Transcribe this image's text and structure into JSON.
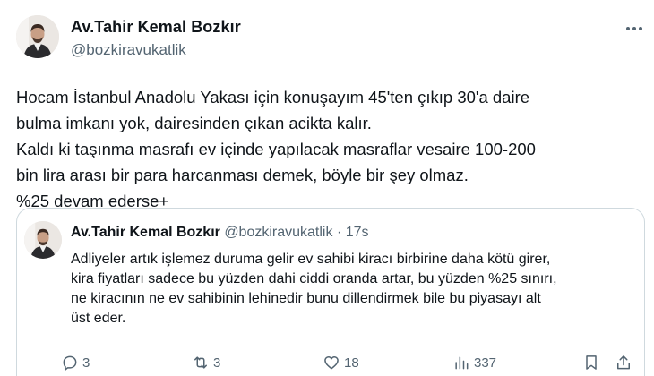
{
  "tweet": {
    "author_name": "Av.Tahir Kemal Bozkır",
    "author_handle": "@bozkiravukatlik",
    "lines": [
      "Hocam İstanbul Anadolu Yakası için konuşayım 45'ten çıkıp 30'a daire",
      "bulma imkanı yok, dairesinden çıkan acikta kalır.",
      "Kaldı ki taşınma masrafı ev içinde yapılacak masraflar vesaire 100-200",
      "bin lira arası bir para harcanması demek, böyle bir şey olmaz.",
      "%25 devam ederse+"
    ]
  },
  "quoted": {
    "author_name": "Av.Tahir Kemal Bozkır",
    "author_handle": "@bozkiravukatlik",
    "separator": "·",
    "time": "17s",
    "lines": [
      "Adliyeler artık işlemez duruma gelir ev sahibi kiracı birbirine daha kötü girer,",
      "kira fiyatları sadece bu yüzden dahi ciddi oranda artar, bu yüzden %25 sınırı,",
      "ne kiracının ne ev sahibinin lehinedir bunu dillendirmek bile bu piyasayı alt",
      "üst eder."
    ]
  },
  "actions": {
    "reply_count": "3",
    "retweet_count": "3",
    "like_count": "18",
    "views_count": "337"
  },
  "icons": {
    "more": "more-horizontal-icon",
    "reply": "reply-icon",
    "retweet": "retweet-icon",
    "like": "heart-icon",
    "views": "views-icon",
    "bookmark": "bookmark-icon",
    "share": "share-icon"
  },
  "colors": {
    "text": "#0f1419",
    "secondary": "#536471",
    "border": "#cfd9de"
  }
}
